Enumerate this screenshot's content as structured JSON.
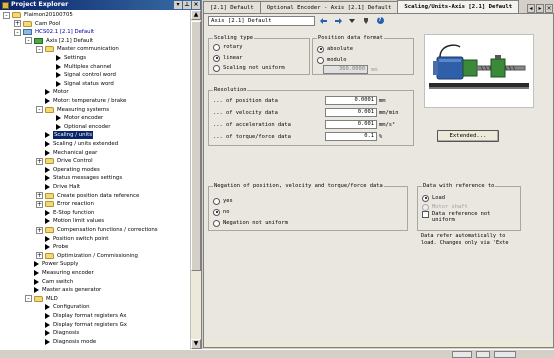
{
  "explorer": {
    "title": "Project Explorer",
    "items": [
      {
        "label": "Flaimon20100705",
        "level": 0,
        "toggle": "-",
        "icon": "folder"
      },
      {
        "label": "Cam Pool",
        "level": 1,
        "toggle": "+",
        "icon": "folder"
      },
      {
        "label": "HCS02.1 [2.1] Default",
        "level": 1,
        "toggle": "-",
        "icon": "drive",
        "blue": true
      },
      {
        "label": "Axis [2.1] Default",
        "level": 2,
        "toggle": "-",
        "icon": "module"
      },
      {
        "label": "Master communication",
        "level": 3,
        "toggle": "-",
        "icon": "folder"
      },
      {
        "label": "Settings",
        "level": 4,
        "icon": "arrow"
      },
      {
        "label": "Multiplex channel",
        "level": 4,
        "icon": "arrow"
      },
      {
        "label": "Signal control word",
        "level": 4,
        "icon": "arrow"
      },
      {
        "label": "Signal status word",
        "level": 4,
        "icon": "arrow"
      },
      {
        "label": "Motor",
        "level": 3,
        "icon": "arrow"
      },
      {
        "label": "Motor: temperature / brake",
        "level": 3,
        "icon": "arrow"
      },
      {
        "label": "Measuring systems",
        "level": 3,
        "toggle": "-",
        "icon": "folder"
      },
      {
        "label": "Motor encoder",
        "level": 4,
        "icon": "arrow"
      },
      {
        "label": "Optional encoder",
        "level": 4,
        "icon": "arrow"
      },
      {
        "label": "Scaling / units",
        "level": 3,
        "icon": "arrow",
        "selected": true
      },
      {
        "label": "Scaling / units extended",
        "level": 3,
        "icon": "arrow"
      },
      {
        "label": "Mechanical gear",
        "level": 3,
        "icon": "arrow"
      },
      {
        "label": "Drive Control",
        "level": 3,
        "toggle": "+",
        "icon": "folder"
      },
      {
        "label": "Operating modes",
        "level": 3,
        "icon": "arrow"
      },
      {
        "label": "Status messages settings",
        "level": 3,
        "icon": "arrow"
      },
      {
        "label": "Drive Halt",
        "level": 3,
        "icon": "arrow"
      },
      {
        "label": "Create position data reference",
        "level": 3,
        "toggle": "+",
        "icon": "folder"
      },
      {
        "label": "Error reaction",
        "level": 3,
        "toggle": "+",
        "icon": "folder"
      },
      {
        "label": "E-Stop function",
        "level": 3,
        "icon": "arrow"
      },
      {
        "label": "Motion limit values",
        "level": 3,
        "icon": "arrow"
      },
      {
        "label": "Compensation functions / corrections",
        "level": 3,
        "toggle": "+",
        "icon": "folder"
      },
      {
        "label": "Position switch point",
        "level": 3,
        "icon": "arrow"
      },
      {
        "label": "Probe",
        "level": 3,
        "icon": "arrow"
      },
      {
        "label": "Optimization / Commissioning",
        "level": 3,
        "toggle": "+",
        "icon": "folder"
      },
      {
        "label": "Power Supply",
        "level": 2,
        "icon": "arrow"
      },
      {
        "label": "Measuring encoder",
        "level": 2,
        "icon": "arrow"
      },
      {
        "label": "Cam switch",
        "level": 2,
        "icon": "arrow"
      },
      {
        "label": "Master axis generator",
        "level": 2,
        "icon": "arrow"
      },
      {
        "label": "MLD",
        "level": 2,
        "toggle": "-",
        "icon": "folder"
      },
      {
        "label": "Configuration",
        "level": 3,
        "icon": "arrow"
      },
      {
        "label": "Display format registers Ax",
        "level": 3,
        "icon": "arrow"
      },
      {
        "label": "Display format registers Gx",
        "level": 3,
        "icon": "arrow"
      },
      {
        "label": "Diagnosis",
        "level": 3,
        "icon": "arrow"
      },
      {
        "label": "Diagnosis mode",
        "level": 3,
        "icon": "arrow"
      }
    ]
  },
  "tabs": [
    {
      "label": "[2.1] Default",
      "active": false
    },
    {
      "label": "Optional Encoder - Axis [2.1] Default",
      "active": false
    },
    {
      "label": "Scaling/Units-Axis [2.1] Default",
      "active": true
    }
  ],
  "toolbar": {
    "axis_value": "Axis [2.1] Default"
  },
  "scaling_type": {
    "title": "Scaling type",
    "options": [
      {
        "label": "rotary",
        "checked": false,
        "disabled": false
      },
      {
        "label": "linear",
        "checked": true,
        "disabled": false
      },
      {
        "label": "Scaling not uniform",
        "checked": false,
        "disabled": false
      }
    ]
  },
  "position_format": {
    "title": "Position data format",
    "options": [
      {
        "label": "absolute",
        "checked": true
      },
      {
        "label": "modulo",
        "checked": false
      }
    ],
    "modulo_value": "360.0000",
    "modulo_unit": "mm"
  },
  "resolution": {
    "title": "Resolution",
    "rows": [
      {
        "label": "... of position data",
        "value": "0.0001",
        "unit": "mm"
      },
      {
        "label": "... of velocity data",
        "value": "0.001",
        "unit": "mm/min"
      },
      {
        "label": "... of acceleration data",
        "value": "0.001",
        "unit": "mm/s²"
      },
      {
        "label": "... of torque/force data",
        "value": "0.1",
        "unit": "%"
      }
    ]
  },
  "extended_button": "Extended...",
  "negation": {
    "title": "Negation of position, velocity and torque/force data",
    "options": [
      {
        "label": "yes",
        "checked": false
      },
      {
        "label": "no",
        "checked": true
      },
      {
        "label": "Negation not uniform",
        "checked": false
      }
    ]
  },
  "data_reference": {
    "title": "Data with reference to",
    "options": [
      {
        "label": "Load",
        "checked": true,
        "disabled": false
      },
      {
        "label": "Motor shaft",
        "checked": false,
        "disabled": true
      }
    ],
    "checkbox_label": "Data reference not uniform",
    "note_line1": "Data refer automatically to",
    "note_line2": "load. Changes only via 'Exte"
  },
  "colors": {
    "titlebar_start": "#0a246a",
    "titlebar_end": "#3a6ea5",
    "selection": "#0a246a",
    "motor_blue": "#2f5fa8",
    "gear_green": "#3a8a3a"
  }
}
